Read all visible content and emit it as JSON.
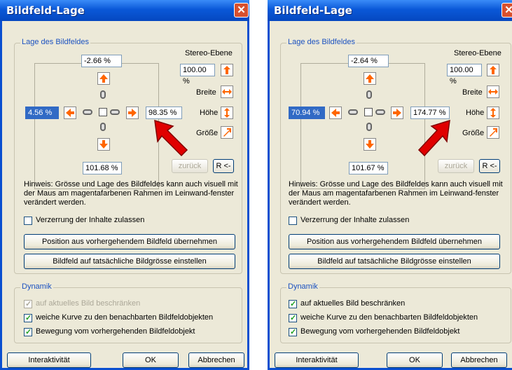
{
  "dialogs": [
    {
      "title": "Bildfeld-Lage",
      "group_lage": "Lage des Bildfeldes",
      "top_value": "-2.66 %",
      "left_value": "4.56 %",
      "right_value": "98.35 %",
      "bottom_value": "101.68 %",
      "stereo_label": "Stereo-Ebene",
      "stereo_value": "100.00 %",
      "breite_label": "Breite",
      "hoehe_label": "Höhe",
      "groesse_label": "Größe",
      "zurueck_label": "zurück",
      "r_label": "R <-",
      "hint": "Hinweis: Grösse und Lage des Bildfeldes kann auch visuell mit der Maus am magentafarbenen Rahmen im Leinwand-fenster verändert werden.",
      "verzerrung_label": "Verzerrung der Inhalte zulassen",
      "verzerrung_checked": false,
      "position_button": "Position aus vorhergehendem Bildfeld übernehmen",
      "bildgroesse_button": "Bildfeld auf tatsächliche Bildgrösse einstellen",
      "group_dynamik": "Dynamik",
      "dyn1_label": "auf aktuelles Bild beschränken",
      "dyn1_checked": true,
      "dyn1_disabled": true,
      "dyn2_label": "weiche Kurve zu den benachbarten Bildfeldobjekten",
      "dyn2_checked": true,
      "dyn3_label": "Bewegung vom vorhergehenden Bildfeldobjekt",
      "dyn3_checked": true,
      "interaktivitaet_button": "Interaktivität",
      "ok_button": "OK",
      "abbrechen_button": "Abbrechen"
    },
    {
      "title": "Bildfeld-Lage",
      "group_lage": "Lage des Bildfeldes",
      "top_value": "-2.64 %",
      "left_value": "70.94 %",
      "right_value": "174.77 %",
      "bottom_value": "101.67 %",
      "stereo_label": "Stereo-Ebene",
      "stereo_value": "100.00 %",
      "breite_label": "Breite",
      "hoehe_label": "Höhe",
      "groesse_label": "Größe",
      "zurueck_label": "zurück",
      "r_label": "R <-",
      "hint": "Hinweis: Grösse und Lage des Bildfeldes kann auch visuell mit der Maus am magentafarbenen Rahmen im Leinwand-fenster verändert werden.",
      "verzerrung_label": "Verzerrung der Inhalte zulassen",
      "verzerrung_checked": false,
      "position_button": "Position aus vorhergehendem Bildfeld übernehmen",
      "bildgroesse_button": "Bildfeld auf tatsächliche Bildgrösse einstellen",
      "group_dynamik": "Dynamik",
      "dyn1_label": "auf aktuelles Bild beschränken",
      "dyn1_checked": true,
      "dyn1_disabled": false,
      "dyn2_label": "weiche Kurve zu den benachbarten Bildfeldobjekten",
      "dyn2_checked": true,
      "dyn3_label": "Bewegung vom vorhergehenden Bildfeldobjekt",
      "dyn3_checked": true,
      "interaktivitaet_button": "Interaktivität",
      "ok_button": "OK",
      "abbrechen_button": "Abbrechen"
    }
  ],
  "colors": {
    "accent_orange": "#ff6600",
    "callout_red": "#e00000",
    "title_blue": "#0a58d8"
  }
}
